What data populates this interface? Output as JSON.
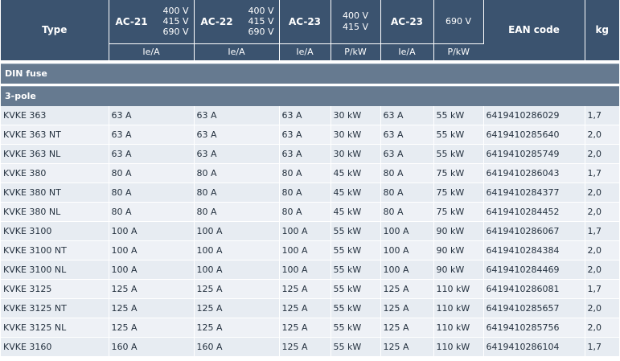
{
  "header": {
    "type": "Type",
    "ac21": "AC-21",
    "ac22": "AC-22",
    "ac23a": "AC-23",
    "ac23b": "AC-23",
    "volts_3": [
      "400 V",
      "415 V",
      "690 V"
    ],
    "volts_2": [
      "400 V",
      "415 V"
    ],
    "volts_690": "690 V",
    "ean": "EAN code",
    "kg": "kg",
    "units": [
      "Ie/A",
      "Ie/A",
      "Ie/A",
      "P/kW",
      "Ie/A",
      "P/kW"
    ]
  },
  "sections": {
    "din": "DIN fuse",
    "pole": "3-pole"
  },
  "rows": [
    [
      "KVKE 363",
      "63 A",
      "63 A",
      "63 A",
      "30 kW",
      "63 A",
      "55 kW",
      "6419410286029",
      "1,7"
    ],
    [
      "KVKE 363 NT",
      "63 A",
      "63 A",
      "63 A",
      "30 kW",
      "63 A",
      "55 kW",
      "6419410285640",
      "2,0"
    ],
    [
      "KVKE 363 NL",
      "63 A",
      "63 A",
      "63 A",
      "30 kW",
      "63 A",
      "55 kW",
      "6419410285749",
      "2,0"
    ],
    [
      "KVKE 380",
      "80 A",
      "80 A",
      "80 A",
      "45 kW",
      "80 A",
      "75 kW",
      "6419410286043",
      "1,7"
    ],
    [
      "KVKE 380 NT",
      "80 A",
      "80 A",
      "80 A",
      "45 kW",
      "80 A",
      "75 kW",
      "6419410284377",
      "2,0"
    ],
    [
      "KVKE 380 NL",
      "80 A",
      "80 A",
      "80 A",
      "45 kW",
      "80 A",
      "75 kW",
      "6419410284452",
      "2,0"
    ],
    [
      "KVKE 3100",
      "100 A",
      "100 A",
      "100 A",
      "55 kW",
      "100 A",
      "90 kW",
      "6419410286067",
      "1,7"
    ],
    [
      "KVKE 3100 NT",
      "100 A",
      "100 A",
      "100 A",
      "55 kW",
      "100 A",
      "90 kW",
      "6419410284384",
      "2,0"
    ],
    [
      "KVKE 3100 NL",
      "100 A",
      "100 A",
      "100 A",
      "55 kW",
      "100 A",
      "90 kW",
      "6419410284469",
      "2,0"
    ],
    [
      "KVKE 3125",
      "125 A",
      "125 A",
      "125 A",
      "55 kW",
      "125 A",
      "110 kW",
      "6419410286081",
      "1,7"
    ],
    [
      "KVKE 3125 NT",
      "125 A",
      "125 A",
      "125 A",
      "55 kW",
      "125 A",
      "110 kW",
      "6419410285657",
      "2,0"
    ],
    [
      "KVKE 3125 NL",
      "125 A",
      "125 A",
      "125 A",
      "55 kW",
      "125 A",
      "110 kW",
      "6419410285756",
      "2,0"
    ],
    [
      "KVKE 3160",
      "160 A",
      "160 A",
      "125 A",
      "55 kW",
      "125 A",
      "110 kW",
      "6419410286104",
      "1,7"
    ]
  ]
}
